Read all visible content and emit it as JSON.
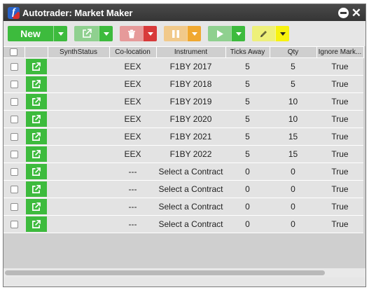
{
  "window": {
    "title": "Autotrader: Market Maker",
    "logo_glyph": "f"
  },
  "toolbar": {
    "new_label": "New",
    "colors": {
      "green": "#3dbb3d",
      "red": "#d83a3a",
      "orange": "#f0a830",
      "yellow": "#f7f20f"
    }
  },
  "table": {
    "columns": [
      "",
      "",
      "SynthStatus",
      "Co-location",
      "Instrument",
      "Ticks Away",
      "Qty",
      "Ignore Mark..."
    ],
    "rows": [
      {
        "synth_status": "",
        "colocation": "EEX",
        "instrument": "F1BY 2017",
        "ticks_away": "5",
        "qty": "5",
        "ignore_market": "True"
      },
      {
        "synth_status": "",
        "colocation": "EEX",
        "instrument": "F1BY 2018",
        "ticks_away": "5",
        "qty": "5",
        "ignore_market": "True"
      },
      {
        "synth_status": "",
        "colocation": "EEX",
        "instrument": "F1BY 2019",
        "ticks_away": "5",
        "qty": "10",
        "ignore_market": "True"
      },
      {
        "synth_status": "",
        "colocation": "EEX",
        "instrument": "F1BY 2020",
        "ticks_away": "5",
        "qty": "10",
        "ignore_market": "True"
      },
      {
        "synth_status": "",
        "colocation": "EEX",
        "instrument": "F1BY 2021",
        "ticks_away": "5",
        "qty": "15",
        "ignore_market": "True"
      },
      {
        "synth_status": "",
        "colocation": "EEX",
        "instrument": "F1BY 2022",
        "ticks_away": "5",
        "qty": "15",
        "ignore_market": "True"
      },
      {
        "synth_status": "",
        "colocation": "---",
        "instrument": "Select a Contract",
        "ticks_away": "0",
        "qty": "0",
        "ignore_market": "True"
      },
      {
        "synth_status": "",
        "colocation": "---",
        "instrument": "Select a Contract",
        "ticks_away": "0",
        "qty": "0",
        "ignore_market": "True"
      },
      {
        "synth_status": "",
        "colocation": "---",
        "instrument": "Select a Contract",
        "ticks_away": "0",
        "qty": "0",
        "ignore_market": "True"
      },
      {
        "synth_status": "",
        "colocation": "---",
        "instrument": "Select a Contract",
        "ticks_away": "0",
        "qty": "0",
        "ignore_market": "True"
      }
    ]
  }
}
